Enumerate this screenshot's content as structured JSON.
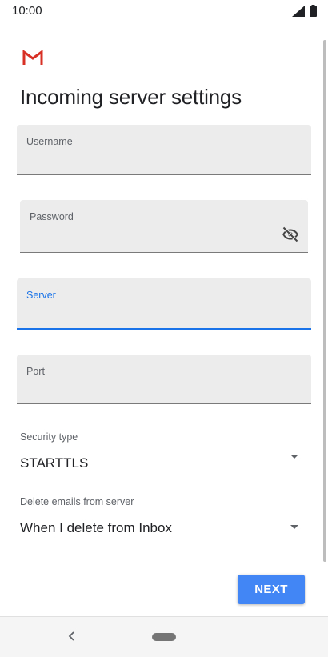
{
  "status": {
    "time": "10:00",
    "signal_icon": "cell-signal-icon",
    "battery_icon": "battery-icon"
  },
  "app": {
    "logo_icon": "gmail-logo-icon"
  },
  "page": {
    "title": "Incoming server settings"
  },
  "form": {
    "username": {
      "label": "Username",
      "value": ""
    },
    "password": {
      "label": "Password",
      "value": "",
      "visibility_icon": "visibility-off-icon"
    },
    "server": {
      "label": "Server",
      "value": "",
      "focused": true
    },
    "port": {
      "label": "Port",
      "value": ""
    },
    "security_type": {
      "label": "Security type",
      "value": "STARTTLS"
    },
    "delete_emails": {
      "label": "Delete emails from server",
      "value": "When I delete from Inbox"
    }
  },
  "actions": {
    "next_label": "NEXT"
  },
  "colors": {
    "accent": "#1a73e8",
    "button": "#4285f4",
    "field_bg": "#ececec"
  },
  "nav": {
    "back_icon": "back-chevron-icon",
    "home_icon": "home-pill-icon"
  }
}
